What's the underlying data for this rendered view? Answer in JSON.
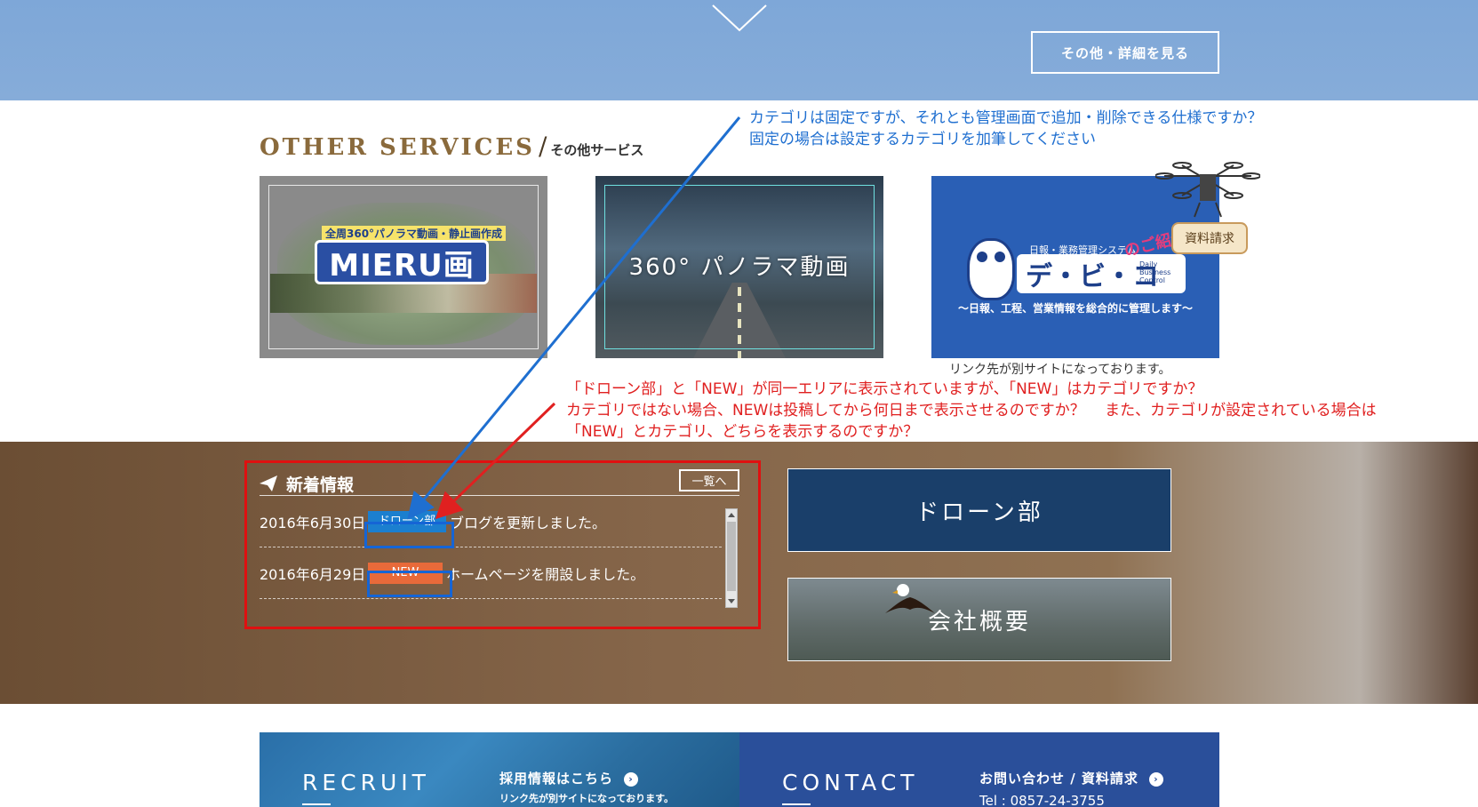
{
  "top": {
    "more_label": "その他・詳細を見る"
  },
  "other_services": {
    "title_en": "OTHER SERVICES",
    "title_sep": "/",
    "title_jp": "その他サービス",
    "cards": [
      {
        "top_text": "全周360°パノラマ動画・静止画作成",
        "logo": "MIERU画"
      },
      {
        "text": "360° パノラマ動画"
      },
      {
        "sub": "日報・業務管理システム",
        "name": "デ・ビ・コ",
        "en": "Daily Business Control",
        "intro": "のご紹介",
        "caption": "～日報、工程、営業情報を総合的に管理します～"
      }
    ],
    "doc_request": "資料請求",
    "link_note": "リンク先が別サイトになっております。"
  },
  "annotations": {
    "blue": [
      "カテゴリは固定ですが、それとも管理画面で追加・削除できる仕様ですか？",
      "固定の場合は設定するカテゴリを加筆してください"
    ],
    "red": [
      "「ドローン部」と「NEW」が同一エリアに表示されていますが、「NEW」はカテゴリですか？",
      "カテゴリではない場合、NEWは投稿してから何日まで表示させるのですか？　 また、カテゴリが設定されている場合は",
      "「NEW」とカテゴリ、どちらを表示するのですか？"
    ]
  },
  "news": {
    "title": "新着情報",
    "list_button": "一覧へ",
    "items": [
      {
        "date": "2016年6月30日",
        "tag": "ドローン部",
        "text": "ブログを更新しました。"
      },
      {
        "date": "2016年6月29日",
        "tag": "NEW",
        "text": "ホームページを開設しました。"
      }
    ]
  },
  "banners": {
    "drone": "ドローン部",
    "company": "会社概要"
  },
  "recruit": {
    "title": "RECRUIT",
    "link": "採用情報はこちら",
    "note": "リンク先が別サイトになっております。"
  },
  "contact": {
    "title": "CONTACT",
    "link": "お問い合わせ / 資料請求",
    "tel": "Tel : 0857-24-3755"
  },
  "colors": {
    "accent_blue": "#1f6fd0",
    "annotation_red": "#e02020",
    "tag_drone": "#1b7fcf",
    "tag_new": "#e86a3a"
  }
}
